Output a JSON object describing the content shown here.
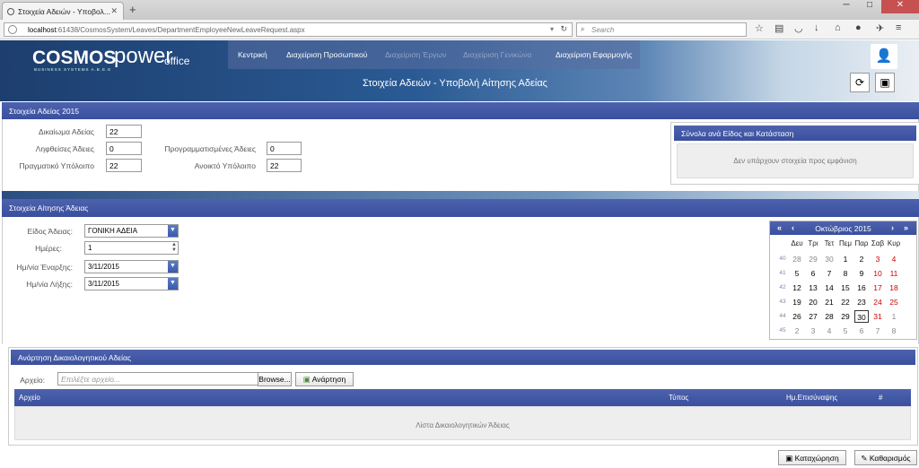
{
  "browser": {
    "tab_title": "Στοιχεία Αδειών - Υποβολ...",
    "url_host": "localhost",
    "url_rest": ":61438/CosmosSystem/Leaves/DepartmentEmployeeNewLeaveRequest.aspx",
    "search_placeholder": "Search"
  },
  "app": {
    "logo_cosmos": "COSMOS",
    "logo_tagline": "BUSINESS SYSTEMS A.B.E.E",
    "logo_power": "power",
    "logo_office": "office",
    "nav": [
      {
        "label": "Κεντρική",
        "enabled": true
      },
      {
        "label": "Διαχείριση Προσωπικού",
        "enabled": true
      },
      {
        "label": "Διαχείριση Έργων",
        "enabled": false
      },
      {
        "label": "Διαχείριση Γενικώνα",
        "enabled": false
      },
      {
        "label": "Διαχείριση Εφαρμογής",
        "enabled": true
      }
    ],
    "page_title": "Στοιχεία Αδειών - Υποβολή Αίτησης Αδείας"
  },
  "leave_info": {
    "header": "Στοιχεία Αδείας 2015",
    "entitlement_label": "Δικαίωμα Αδείας",
    "entitlement_value": "22",
    "taken_label": "Ληφθείσες Άδειες",
    "taken_value": "0",
    "scheduled_label": "Προγραμματισμένες Άδειες",
    "scheduled_value": "0",
    "actual_balance_label": "Πραγματικό Υπόλοιπο",
    "actual_balance_value": "22",
    "open_balance_label": "Ανοικτό Υπόλοιπο",
    "open_balance_value": "22",
    "totals_header": "Σύνολα ανά Είδος και Κατάσταση",
    "totals_empty": "Δεν υπάρχουν στοιχεία προς εμφάνιση"
  },
  "request": {
    "header": "Στοιχεία Αίτησης Άδειας",
    "type_label": "Είδος Άδειας:",
    "type_value": "ΓΟΝΙΚΗ ΑΔΕΙΑ",
    "days_label": "Ημέρες:",
    "days_value": "1",
    "start_label": "Ημ/νία Έναρξης:",
    "start_value": "3/11/2015",
    "end_label": "Ημ/νία Λήξης:",
    "end_value": "3/11/2015"
  },
  "calendar": {
    "month_label": "Οκτώβριος 2015",
    "weekdays": [
      "Δευ",
      "Τρι",
      "Τετ",
      "Πεμ",
      "Παρ",
      "Σαβ",
      "Κυρ"
    ],
    "weeks": [
      {
        "no": "40",
        "days": [
          "28",
          "29",
          "30",
          "1",
          "2",
          "3",
          "4"
        ]
      },
      {
        "no": "41",
        "days": [
          "5",
          "6",
          "7",
          "8",
          "9",
          "10",
          "11"
        ]
      },
      {
        "no": "42",
        "days": [
          "12",
          "13",
          "14",
          "15",
          "16",
          "17",
          "18"
        ]
      },
      {
        "no": "43",
        "days": [
          "19",
          "20",
          "21",
          "22",
          "23",
          "24",
          "25"
        ]
      },
      {
        "no": "44",
        "days": [
          "26",
          "27",
          "28",
          "29",
          "30",
          "31",
          "1"
        ]
      },
      {
        "no": "45",
        "days": [
          "2",
          "3",
          "4",
          "5",
          "6",
          "7",
          "8"
        ]
      }
    ],
    "selected_day": "30",
    "weekend_color": "#cc0000"
  },
  "upload": {
    "header": "Ανάρτηση Δικαιολογητικού Αδείας",
    "file_label": "Αρχείο:",
    "file_placeholder": "Επιλέξτε αρχείο...",
    "browse_label": "Browse...",
    "upload_label": "Ανάρτηση",
    "columns": [
      "Αρχείο",
      "Τύπος",
      "Ημ.Επισύναψης",
      "#"
    ],
    "empty_text": "Λίστα Δικαιολογητικών Άδειας"
  },
  "actions": {
    "save_label": "Καταχώρηση",
    "clear_label": "Καθαρισμός"
  },
  "colors": {
    "section_header": "#3f54a2",
    "brand_dark": "#1d3e6e"
  }
}
